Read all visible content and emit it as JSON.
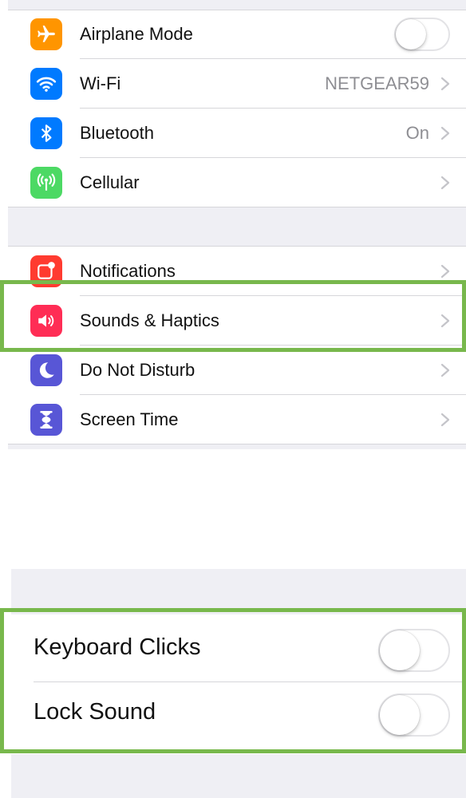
{
  "settings_group_1": {
    "rows": [
      {
        "label": "Airplane Mode",
        "icon": "airplane-icon",
        "color": "#ff9500",
        "toggle": false
      },
      {
        "label": "Wi-Fi",
        "icon": "wifi-icon",
        "color": "#007aff",
        "value": "NETGEAR59"
      },
      {
        "label": "Bluetooth",
        "icon": "bluetooth-icon",
        "color": "#007aff",
        "value": "On"
      },
      {
        "label": "Cellular",
        "icon": "cellular-antenna-icon",
        "color": "#4cd964"
      }
    ]
  },
  "settings_group_2": {
    "rows": [
      {
        "label": "Notifications",
        "icon": "notifications-icon",
        "color": "#ff3b30"
      },
      {
        "label": "Sounds & Haptics",
        "icon": "speaker-icon",
        "color": "#ff2d55",
        "highlighted": true
      },
      {
        "label": "Do Not Disturb",
        "icon": "moon-icon",
        "color": "#5856d6"
      },
      {
        "label": "Screen Time",
        "icon": "hourglass-icon",
        "color": "#5856d6"
      }
    ]
  },
  "sounds_panel": {
    "rows": [
      {
        "label": "Keyboard Clicks",
        "toggle": false
      },
      {
        "label": "Lock Sound",
        "toggle": false
      }
    ],
    "highlighted": true
  },
  "colors": {
    "highlight": "#78b84c",
    "grouped_background": "#efeff4"
  }
}
